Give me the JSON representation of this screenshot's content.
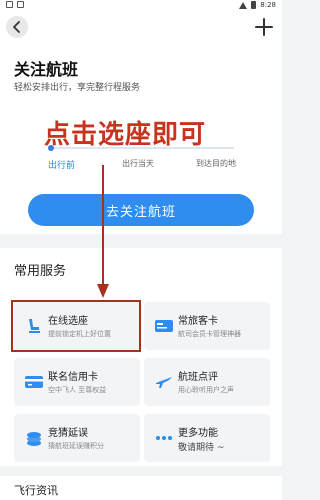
{
  "status": {
    "time": "8:28"
  },
  "hero": {
    "title": "关注航班",
    "subtitle": "轻松安排出行，享完整行程服务",
    "overlay_text": "点击选座即可",
    "steps": [
      "出行前",
      "出行当天",
      "到达目的地"
    ],
    "cta_label": "去关注航班"
  },
  "services": {
    "title": "常用服务",
    "cards": [
      {
        "title": "在线选座",
        "subtitle": "提前锁定机上好位置",
        "icon": "seat-icon"
      },
      {
        "title": "常旅客卡",
        "subtitle": "航司会员卡管理神器",
        "icon": "member-card-icon"
      },
      {
        "title": "联名信用卡",
        "subtitle": "空中飞人 至尊权益",
        "icon": "credit-card-icon"
      },
      {
        "title": "航班点评",
        "subtitle": "用心聆听用户之声",
        "icon": "plane-review-icon"
      },
      {
        "title": "竞猜延误",
        "subtitle": "猜航班延误赚积分",
        "icon": "coin-icon"
      },
      {
        "title": "更多功能",
        "subtitle": "敬请期待 ~",
        "icon": "more-dots-icon"
      }
    ]
  },
  "bottom": {
    "section_title": "飞行资讯"
  },
  "colors": {
    "accent": "#2f8df0",
    "overlay": "#c8331e",
    "highlight": "#a4321e"
  }
}
